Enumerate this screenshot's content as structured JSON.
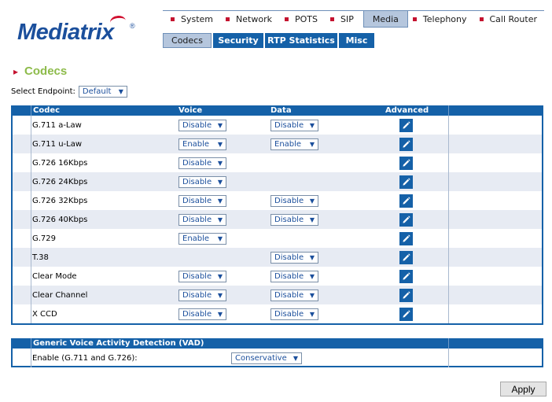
{
  "brand": {
    "name": "Mediatrix",
    "reg": "®"
  },
  "topnav": [
    {
      "label": "System"
    },
    {
      "label": "Network"
    },
    {
      "label": "POTS"
    },
    {
      "label": "SIP"
    },
    {
      "label": "Media",
      "active": true
    },
    {
      "label": "Telephony"
    },
    {
      "label": "Call Router"
    }
  ],
  "subnav": [
    {
      "label": "Codecs",
      "active": true
    },
    {
      "label": "Security"
    },
    {
      "label": "RTP Statistics"
    },
    {
      "label": "Misc"
    }
  ],
  "page": {
    "title": "Codecs"
  },
  "endpoint": {
    "label": "Select Endpoint:",
    "value": "Default"
  },
  "codecs_table": {
    "headers": {
      "codec": "Codec",
      "voice": "Voice",
      "data": "Data",
      "advanced": "Advanced"
    },
    "rows": [
      {
        "codec": "G.711 a-Law",
        "voice": "Disable",
        "data": "Disable"
      },
      {
        "codec": "G.711 u-Law",
        "voice": "Enable",
        "data": "Enable"
      },
      {
        "codec": "G.726 16Kbps",
        "voice": "Disable",
        "data": null
      },
      {
        "codec": "G.726 24Kbps",
        "voice": "Disable",
        "data": null
      },
      {
        "codec": "G.726 32Kbps",
        "voice": "Disable",
        "data": "Disable"
      },
      {
        "codec": "G.726 40Kbps",
        "voice": "Disable",
        "data": "Disable"
      },
      {
        "codec": "G.729",
        "voice": "Enable",
        "data": null
      },
      {
        "codec": "T.38",
        "voice": null,
        "data": "Disable"
      },
      {
        "codec": "Clear Mode",
        "voice": "Disable",
        "data": "Disable"
      },
      {
        "codec": "Clear Channel",
        "voice": "Disable",
        "data": "Disable"
      },
      {
        "codec": "X CCD",
        "voice": "Disable",
        "data": "Disable"
      }
    ]
  },
  "vad": {
    "title": "Generic Voice Activity Detection (VAD)",
    "label": "Enable (G.711 and G.726):",
    "value": "Conservative"
  },
  "actions": {
    "apply_label": "Apply"
  },
  "colors": {
    "brand_blue": "#1561a8",
    "accent_red": "#c4122f",
    "title_green": "#8dbb4a",
    "row_alt": "#e7ebf3"
  },
  "icons": {
    "edit": "pencil-icon",
    "dropdown": "chevron-down-icon"
  }
}
